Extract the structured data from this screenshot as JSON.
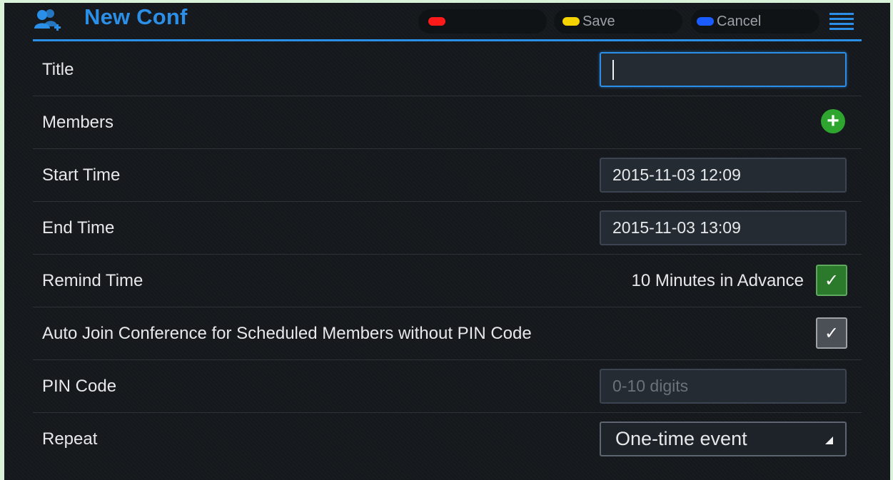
{
  "header": {
    "title": "New Conf",
    "icon": "add-contacts-icon",
    "softkeys": [
      {
        "label": "",
        "color": "#ff1a1a"
      },
      {
        "label": "Save",
        "color": "#f5d300"
      },
      {
        "label": "Cancel",
        "color": "#1a5cff"
      }
    ],
    "menu_icon": "menu-icon"
  },
  "form": {
    "title": {
      "label": "Title",
      "value": ""
    },
    "members": {
      "label": "Members",
      "add_icon": "plus-icon"
    },
    "start_time": {
      "label": "Start Time",
      "value": "2015-11-03 12:09"
    },
    "end_time": {
      "label": "End Time",
      "value": "2015-11-03 13:09"
    },
    "remind_time": {
      "label": "Remind Time",
      "value": "10 Minutes in Advance",
      "checked": true
    },
    "auto_join": {
      "label": "Auto Join Conference for Scheduled Members without PIN Code",
      "checked": true
    },
    "pin_code": {
      "label": "PIN Code",
      "placeholder": "0-10 digits"
    },
    "repeat": {
      "label": "Repeat",
      "value": "One-time event"
    }
  },
  "colors": {
    "accent": "#2b8fe8",
    "background": "#15181c",
    "check_green": "#2b7a2b",
    "add_green": "#2ea52f"
  }
}
